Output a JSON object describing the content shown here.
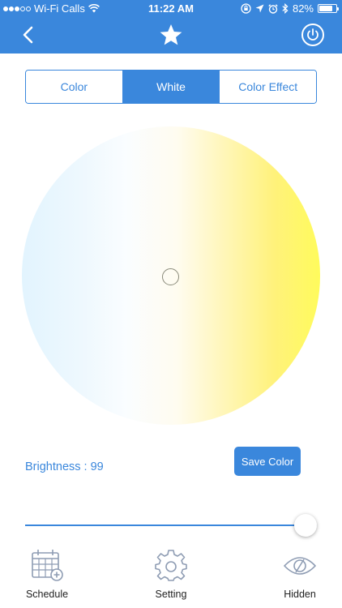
{
  "status_bar": {
    "carrier": "Wi-Fi Calls",
    "time": "11:22 AM",
    "battery": "82%",
    "battery_level": 0.82,
    "signal_bars_filled": 3,
    "signal_bars_total": 5
  },
  "nav": {
    "back_icon": "chevron-left-icon",
    "center_icon": "star-icon",
    "right_icon": "power-icon"
  },
  "segment": {
    "tabs": [
      {
        "label": "Color",
        "active": false
      },
      {
        "label": "White",
        "active": true
      },
      {
        "label": "Color Effect",
        "active": false
      }
    ]
  },
  "wheel": {
    "gradient_colors": [
      "#e2f4fe",
      "#fafdff",
      "#fff6b8",
      "#fffb5c"
    ]
  },
  "brightness": {
    "label": "Brightness : 99",
    "value": 99,
    "max": 100
  },
  "save_button": {
    "label": "Save Color"
  },
  "toolbar": {
    "items": [
      {
        "label": "Schedule",
        "icon": "calendar-add-icon"
      },
      {
        "label": "Setting",
        "icon": "gear-icon"
      },
      {
        "label": "Hidden",
        "icon": "eye-off-icon"
      }
    ]
  },
  "colors": {
    "accent": "#3a87dc",
    "header_text": "#ffffff",
    "icon_gray": "#8e9cb3"
  }
}
